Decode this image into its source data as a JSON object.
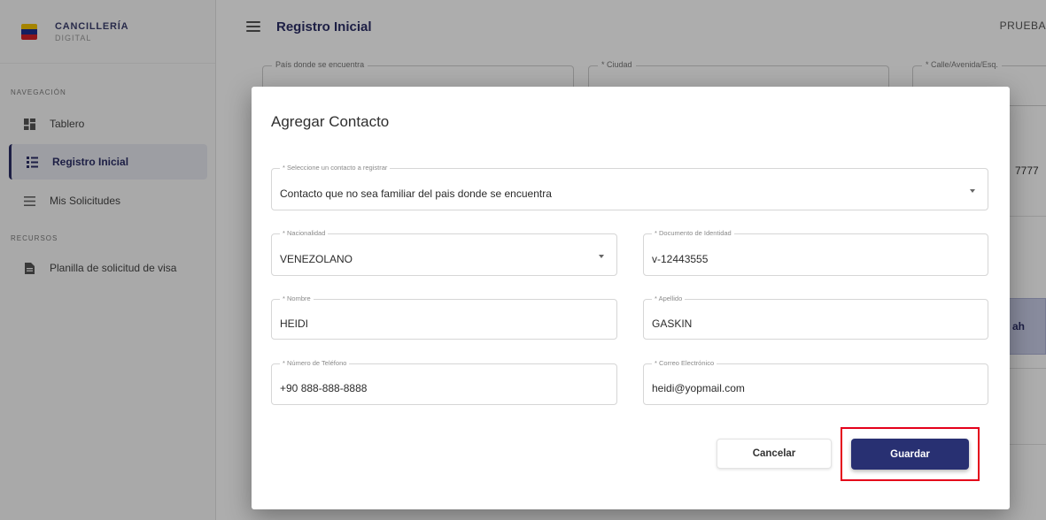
{
  "brand": {
    "title": "CANCILLERÍA",
    "subtitle": "DIGITAL"
  },
  "sidebar": {
    "nav_section": "NAVEGACIÓN",
    "items": [
      {
        "label": "Tablero",
        "icon": "dashboard-icon"
      },
      {
        "label": "Registro Inicial",
        "icon": "registry-icon",
        "active": true
      },
      {
        "label": "Mis Solicitudes",
        "icon": "list-icon"
      }
    ],
    "resources_section": "RECURSOS",
    "resources": [
      {
        "label": "Planilla de solicitud de visa",
        "icon": "document-icon"
      }
    ]
  },
  "header": {
    "title": "Registro Inicial",
    "user": "PRUEBA"
  },
  "background_form": {
    "field1_label": "País donde se encuentra",
    "field2_label": "* Ciudad",
    "field3_label": "* Calle/Avenida/Esq.",
    "phone_fragment": "7777",
    "button_fragment": "ah"
  },
  "modal": {
    "title": "Agregar Contacto",
    "contact_type": {
      "label": "* Seleccione un contacto a registrar",
      "value": "Contacto que no sea familiar del pais donde se encuentra"
    },
    "nationality": {
      "label": "* Nacionalidad",
      "value": "VENEZOLANO"
    },
    "id_document": {
      "label": "* Documento de Identidad",
      "value": "v-12443555"
    },
    "first_name": {
      "label": "* Nombre",
      "value": "HEIDI"
    },
    "last_name": {
      "label": "* Apellido",
      "value": "GASKIN"
    },
    "phone": {
      "label": "* Número de Teléfono",
      "value": "+90 888-888-8888"
    },
    "email": {
      "label": "* Correo Electrónico",
      "value": "heidi@yopmail.com"
    },
    "cancel_label": "Cancelar",
    "save_label": "Guardar"
  },
  "colors": {
    "primary": "#283072",
    "highlight": "#e4001b",
    "active_nav_bg": "#e8e9f0"
  }
}
